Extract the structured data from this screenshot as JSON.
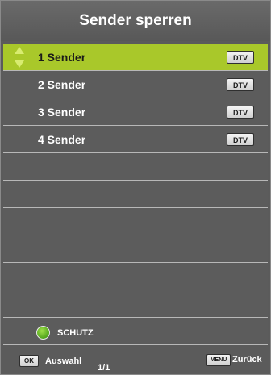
{
  "title": "Sender sperren",
  "channels": [
    {
      "label": "1 Sender",
      "badge": "DTV",
      "selected": true
    },
    {
      "label": "2 Sender",
      "badge": "DTV",
      "selected": false
    },
    {
      "label": "3 Sender",
      "badge": "DTV",
      "selected": false
    },
    {
      "label": "4 Sender",
      "badge": "DTV",
      "selected": false
    }
  ],
  "empty_rows": 7,
  "footer": {
    "schutz_label": "SCHUTZ",
    "ok_key": "OK",
    "auswahl_label": "Auswahl",
    "page_indicator": "1/1",
    "menu_key": "MENU",
    "zurueck_label": "Zurück"
  },
  "colors": {
    "panel_bg": "#5b5b5b",
    "selected_bg": "#a9c82a",
    "green_button": "#52a51b",
    "arrow_color": "#c8e05a"
  },
  "icons": {
    "selection_arrows": "up-down-arrows-icon",
    "green_button": "green-circle-icon"
  }
}
